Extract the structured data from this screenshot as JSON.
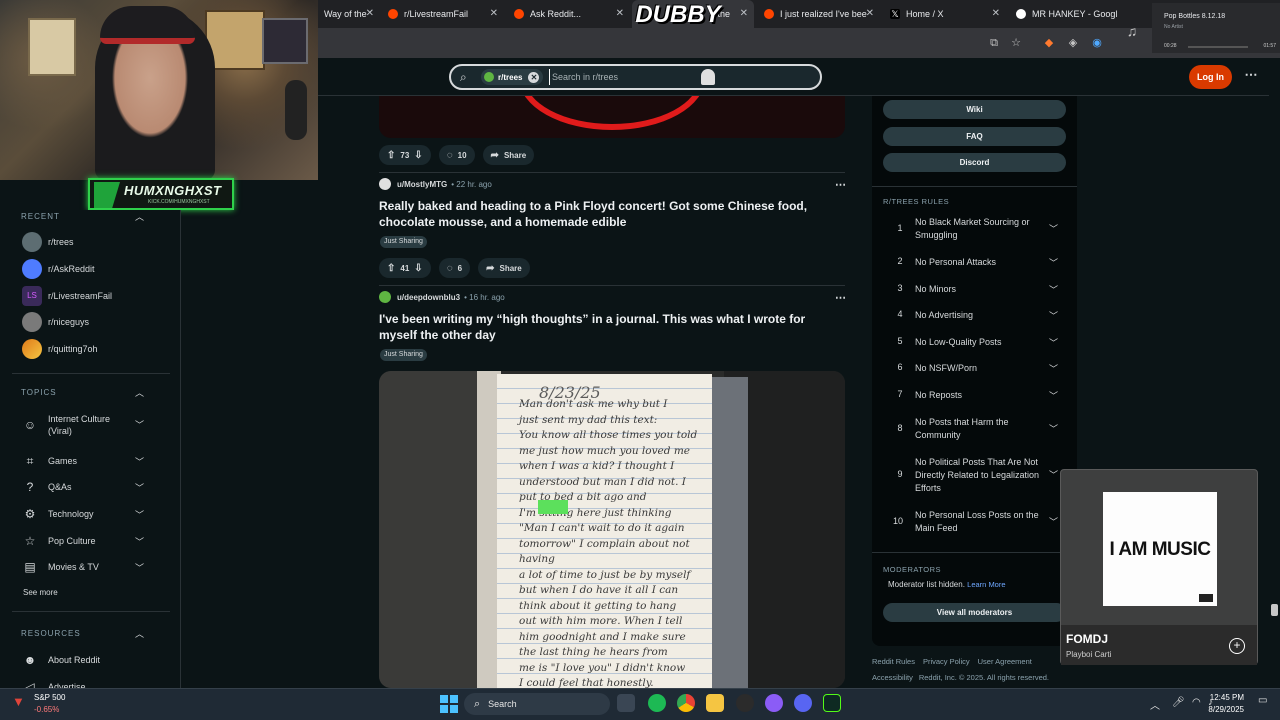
{
  "stream": {
    "overlay_title": "DUBBY",
    "badge_name": "HUMXNGHXST",
    "badge_sub": "KICK.COM/HUMXNGHXST"
  },
  "browser": {
    "tabs": [
      {
        "label": "Way of the",
        "active": false
      },
      {
        "label": "r/LivestreamFail",
        "active": false
      },
      {
        "label": "Ask Reddit...",
        "active": false
      },
      {
        "label": "the",
        "active": true
      },
      {
        "label": "I just realized I've bee",
        "active": false
      },
      {
        "label": "Home / X",
        "active": false
      },
      {
        "label": "MR HANKEY - Googl",
        "active": false
      }
    ],
    "media": {
      "title": "Pop Bottles 8.12.18",
      "artist": "No Artist",
      "time_elapsed": "00:28",
      "time_total": "01:57"
    }
  },
  "reddit": {
    "search": {
      "community_chip": "r/trees",
      "placeholder": "Search in r/trees"
    },
    "login_label": "Log In",
    "left_nav": {
      "recent_header": "RECENT",
      "recent": [
        {
          "label": "r/trees",
          "color": "#5d6d72"
        },
        {
          "label": "r/AskReddit",
          "color": "#4f7cff"
        },
        {
          "label": "r/LivestreamFail",
          "color": "#3a2a5a"
        },
        {
          "label": "r/niceguys",
          "color": "#7a7a7a"
        },
        {
          "label": "r/quitting7oh",
          "color": "#e07b1a"
        }
      ],
      "topics_header": "TOPICS",
      "topics": [
        {
          "label": "Internet Culture (Viral)",
          "icon": "internet-culture-icon"
        },
        {
          "label": "Games",
          "icon": "gamepad-icon"
        },
        {
          "label": "Q&As",
          "icon": "qa-icon"
        },
        {
          "label": "Technology",
          "icon": "technology-icon"
        },
        {
          "label": "Pop Culture",
          "icon": "star-icon"
        },
        {
          "label": "Movies & TV",
          "icon": "clapper-icon"
        }
      ],
      "see_more": "See more",
      "resources_header": "RESOURCES",
      "resources": [
        {
          "label": "About Reddit",
          "icon": "reddit-icon"
        },
        {
          "label": "Advertise",
          "icon": "megaphone-icon"
        }
      ]
    },
    "post0": {
      "votes": "73",
      "comments": "10",
      "share": "Share"
    },
    "post1": {
      "user": "u/MostlyMTG",
      "age": "• 22 hr. ago",
      "title": "Really baked and heading to a Pink Floyd concert! Got some Chinese food, chocolate mousse, and a homemade edible",
      "flair": "Just Sharing",
      "votes": "41",
      "comments": "6",
      "share": "Share"
    },
    "post2": {
      "user": "u/deepdownblu3",
      "age": "• 16 hr. ago",
      "title": "I've been writing my “high thoughts” in a journal. This was what I wrote for myself the other day",
      "flair": "Just Sharing",
      "journal_date": "8/23/25",
      "journal_text": "Man don't ask me why but I\njust sent my dad this text:\nYou know all those times you told\nme just how much you loved me\nwhen I was a kid? I thought I\nunderstood but man I did not. I\nput        to bed a bit ago and\nI'm sitting here just thinking\n\"Man I can't wait to do it again\ntomorrow\" I complain about not having\na lot of time to just be by myself\nbut when I do have it all I can\nthink about it getting to hang\nout with him more. When I tell\nhim goodnight and I make sure\nthe last thing he hears from\nme is \"I love you\" I didn't know\nI could feel that honestly."
    },
    "sidebar": {
      "buttons": [
        "Wiki",
        "FAQ",
        "Discord"
      ],
      "rules_header": "R/TREES RULES",
      "rules": [
        {
          "n": "1",
          "text": "No Black Market Sourcing or Smuggling"
        },
        {
          "n": "2",
          "text": "No Personal Attacks"
        },
        {
          "n": "3",
          "text": "No Minors"
        },
        {
          "n": "4",
          "text": "No Advertising"
        },
        {
          "n": "5",
          "text": "No Low-Quality Posts"
        },
        {
          "n": "6",
          "text": "No NSFW/Porn"
        },
        {
          "n": "7",
          "text": "No Reposts"
        },
        {
          "n": "8",
          "text": "No Posts that Harm the Community"
        },
        {
          "n": "9",
          "text": "No Political Posts That Are Not Directly Related to Legalization Efforts"
        },
        {
          "n": "10",
          "text": "No Personal Loss Posts on the Main Feed"
        }
      ],
      "moderators_header": "MODERATORS",
      "moderators_note": "Moderator list hidden.",
      "learn_more": "Learn More",
      "view_moderators": "View all moderators"
    },
    "footer": {
      "links": [
        "Reddit Rules",
        "Privacy Policy",
        "User Agreement"
      ],
      "links2": [
        "Accessibility",
        "Reddit, Inc. © 2025. All rights reserved."
      ]
    }
  },
  "spotify": {
    "album_art_text": "I AM MUSIC",
    "song": "FOMDJ",
    "artist": "Playboi Carti"
  },
  "taskbar": {
    "stock_name": "S&P 500",
    "stock_change": "-0.65%",
    "search_label": "Search",
    "time": "12:45 PM",
    "date": "8/29/2025"
  }
}
